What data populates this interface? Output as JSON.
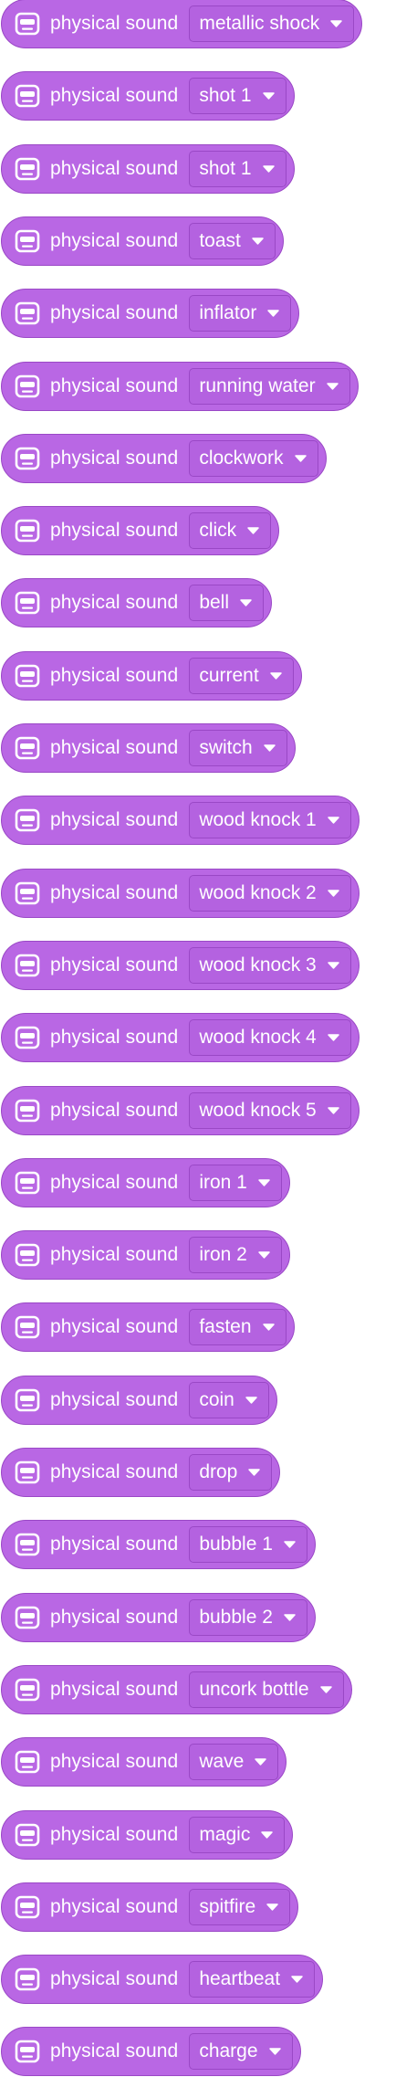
{
  "blocks": [
    {
      "label": "physical sound",
      "value": "metallic shock",
      "icon": "robot-icon"
    },
    {
      "label": "physical sound",
      "value": "shot 1",
      "icon": "robot-icon"
    },
    {
      "label": "physical sound",
      "value": "shot 1",
      "icon": "robot-icon"
    },
    {
      "label": "physical sound",
      "value": "toast",
      "icon": "robot-icon"
    },
    {
      "label": "physical sound",
      "value": "inflator",
      "icon": "robot-icon"
    },
    {
      "label": "physical sound",
      "value": "running water",
      "icon": "robot-icon"
    },
    {
      "label": "physical sound",
      "value": "clockwork",
      "icon": "robot-icon"
    },
    {
      "label": "physical sound",
      "value": "click",
      "icon": "robot-icon"
    },
    {
      "label": "physical sound",
      "value": "bell",
      "icon": "robot-icon"
    },
    {
      "label": "physical sound",
      "value": "current",
      "icon": "robot-icon"
    },
    {
      "label": "physical sound",
      "value": "switch",
      "icon": "robot-icon"
    },
    {
      "label": "physical sound",
      "value": "wood knock 1",
      "icon": "robot-icon"
    },
    {
      "label": "physical sound",
      "value": "wood knock 2",
      "icon": "robot-icon"
    },
    {
      "label": "physical sound",
      "value": "wood knock 3",
      "icon": "robot-icon"
    },
    {
      "label": "physical sound",
      "value": "wood knock 4",
      "icon": "robot-icon"
    },
    {
      "label": "physical sound",
      "value": "wood knock 5",
      "icon": "robot-icon"
    },
    {
      "label": "physical sound",
      "value": "iron 1",
      "icon": "robot-icon"
    },
    {
      "label": "physical sound",
      "value": "iron 2",
      "icon": "robot-icon"
    },
    {
      "label": "physical sound",
      "value": "fasten",
      "icon": "robot-icon"
    },
    {
      "label": "physical sound",
      "value": "coin",
      "icon": "robot-icon"
    },
    {
      "label": "physical sound",
      "value": "drop",
      "icon": "robot-icon"
    },
    {
      "label": "physical sound",
      "value": "bubble 1",
      "icon": "robot-icon"
    },
    {
      "label": "physical sound",
      "value": "bubble 2",
      "icon": "robot-icon"
    },
    {
      "label": "physical sound",
      "value": "uncork bottle",
      "icon": "robot-icon"
    },
    {
      "label": "physical sound",
      "value": "wave",
      "icon": "robot-icon"
    },
    {
      "label": "physical sound",
      "value": "magic",
      "icon": "robot-icon"
    },
    {
      "label": "physical sound",
      "value": "spitfire",
      "icon": "robot-icon"
    },
    {
      "label": "physical sound",
      "value": "heartbeat",
      "icon": "robot-icon"
    },
    {
      "label": "physical sound",
      "value": "charge",
      "icon": "robot-icon"
    }
  ],
  "colors": {
    "block_fill": "#b967e4",
    "block_border": "#9a48c6",
    "text": "#ffffff"
  }
}
